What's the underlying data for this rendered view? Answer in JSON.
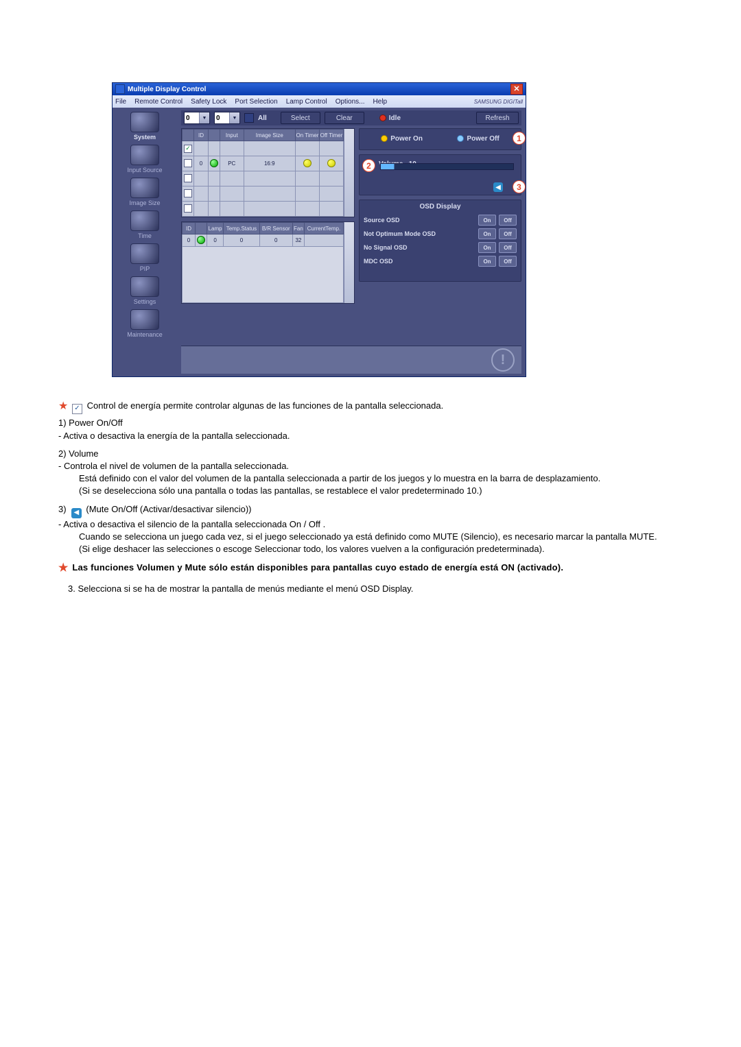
{
  "window": {
    "title": "Multiple Display Control",
    "brand": "SAMSUNG DIGITall",
    "menu": [
      "File",
      "Remote Control",
      "Safety Lock",
      "Port Selection",
      "Lamp Control",
      "Options...",
      "Help"
    ],
    "sidebar": [
      {
        "label": "System"
      },
      {
        "label": "Input Source"
      },
      {
        "label": "Image Size"
      },
      {
        "label": "Time"
      },
      {
        "label": "PIP"
      },
      {
        "label": "Settings"
      },
      {
        "label": "Maintenance"
      }
    ],
    "toolbar": {
      "v1": "0",
      "v2": "0",
      "all": "All",
      "select": "Select",
      "clear": "Clear",
      "idle": "Idle",
      "refresh": "Refresh"
    },
    "table1": {
      "headers": [
        "",
        "ID",
        "",
        "Input",
        "Image Size",
        "On Timer",
        "Off Timer"
      ],
      "rows": [
        {
          "chk": true,
          "id": "",
          "lamp": "",
          "input": "",
          "size": "",
          "on": "",
          "off": ""
        },
        {
          "chk": false,
          "id": "0",
          "lamp": "green",
          "input": "PC",
          "size": "16:9",
          "on": "y",
          "off": "y"
        },
        {
          "chk": false,
          "id": "",
          "lamp": "",
          "input": "",
          "size": "",
          "on": "",
          "off": ""
        },
        {
          "chk": false,
          "id": "",
          "lamp": "",
          "input": "",
          "size": "",
          "on": "",
          "off": ""
        },
        {
          "chk": false,
          "id": "",
          "lamp": "",
          "input": "",
          "size": "",
          "on": "",
          "off": ""
        }
      ]
    },
    "table2": {
      "headers": [
        "ID",
        "",
        "Lamp",
        "Temp.Status",
        "B/R Sensor",
        "Fan",
        "CurrentTemp."
      ],
      "rows": [
        {
          "id": "0",
          "mark": "green",
          "lamp": "0",
          "temp": "0",
          "br": "0",
          "fan": "32",
          "cur": ""
        }
      ]
    },
    "panel": {
      "power_on": "Power On",
      "power_off": "Power Off",
      "volume_label": "Volume",
      "volume_value": "10",
      "osd_title": "OSD Display",
      "osd_rows": [
        {
          "label": "Source OSD"
        },
        {
          "label": "Not Optimum Mode OSD"
        },
        {
          "label": "No Signal OSD"
        },
        {
          "label": "MDC OSD"
        }
      ],
      "on": "On",
      "off": "Off"
    },
    "callouts": {
      "c1": "1",
      "c2": "2",
      "c3": "3"
    }
  },
  "doc": {
    "intro": "Control de energía permite controlar algunas de las funciones de la pantalla seleccionada.",
    "i1_title": "Power On/Off",
    "i1_desc": "- Activa o desactiva la energía de la pantalla seleccionada.",
    "i2_title": "Volume",
    "i2_d1": "- Controla el nivel de volumen de la pantalla seleccionada.",
    "i2_d2": "Está definido con el valor del volumen de la pantalla seleccionada a partir de los juegos y lo muestra en la barra de desplazamiento.",
    "i2_d3": "(Si se deselecciona sólo una pantalla o todas las pantallas, se restablece el valor predeterminado 10.)",
    "i3_title": "(Mute On/Off (Activar/desactivar silencio))",
    "i3_d1": "- Activa o desactiva el silencio de la pantalla seleccionada On / Off .",
    "i3_d2": "Cuando se selecciona un juego cada vez, si el juego seleccionado ya está definido como MUTE (Silencio), es necesario marcar la pantalla MUTE.",
    "i3_d3": "(Si elige deshacer las selecciones o escoge Seleccionar todo, los valores vuelven a la configuración predeterminada).",
    "note": "Las funciones Volumen y Mute sólo están disponibles para pantallas cuyo estado de energía está ON (activado).",
    "i4": "3.  Selecciona si se ha de mostrar la pantalla de menús mediante el menú OSD Display."
  }
}
